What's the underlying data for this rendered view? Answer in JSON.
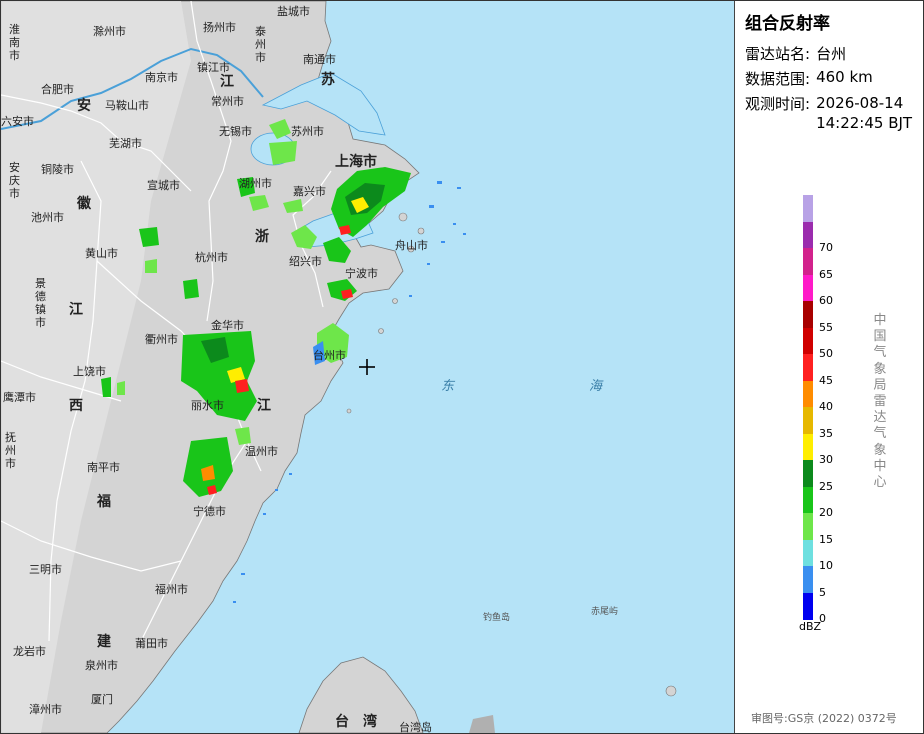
{
  "panel": {
    "title": "组合反射率",
    "station_key": "雷达站名:",
    "station_val": "台州",
    "range_key": "数据范围:",
    "range_val": "460 km",
    "time_key": "观测时间:",
    "time_date": "2026-08-14",
    "time_clock": "14:22:45 BJT",
    "vertical_text": "中国气象局雷达气象中心",
    "unit": "dBZ",
    "review": "审图号:GS京 (2022) 0372号"
  },
  "legend": [
    {
      "value": "",
      "color": "#b8a2e6"
    },
    {
      "value": "70",
      "color": "#9b2cae"
    },
    {
      "value": "65",
      "color": "#d2228c"
    },
    {
      "value": "60",
      "color": "#ff1ac8"
    },
    {
      "value": "55",
      "color": "#a80000"
    },
    {
      "value": "50",
      "color": "#d00000"
    },
    {
      "value": "45",
      "color": "#ff2020"
    },
    {
      "value": "40",
      "color": "#ff8c00"
    },
    {
      "value": "35",
      "color": "#e6b800"
    },
    {
      "value": "30",
      "color": "#ffee00"
    },
    {
      "value": "25",
      "color": "#0c8a1c"
    },
    {
      "value": "20",
      "color": "#19c519"
    },
    {
      "value": "15",
      "color": "#6ee64a"
    },
    {
      "value": "10",
      "color": "#6ee0e0"
    },
    {
      "value": "5",
      "color": "#3a8ff0"
    },
    {
      "value": "0",
      "color": "#0000f0"
    }
  ],
  "map": {
    "provinces": [
      "苏",
      "江",
      "安",
      "徽",
      "浙",
      "江",
      "江",
      "西",
      "福",
      "建",
      "台",
      "湾"
    ],
    "sea": [
      "东",
      "海"
    ],
    "islands": [
      "钓鱼岛",
      "赤尾屿",
      "台湾岛"
    ],
    "cities": [
      "淮南市",
      "滁州市",
      "扬州市",
      "泰州市",
      "盐城市",
      "合肥市",
      "南京市",
      "镇江市",
      "南通市",
      "六安市",
      "马鞍山市",
      "常州市",
      "芜湖市",
      "无锡市",
      "苏州市",
      "安庆市",
      "铜陵市",
      "宣城市",
      "上海市",
      "湖州市",
      "嘉兴市",
      "池州市",
      "黄山市",
      "杭州市",
      "绍兴市",
      "舟山市",
      "景德镇市",
      "宁波市",
      "衢州市",
      "金华市",
      "台州市",
      "上饶市",
      "鹰潭市",
      "丽水市",
      "抚州市",
      "温州市",
      "南平市",
      "宁德市",
      "三明市",
      "福州市",
      "龙岩市",
      "莆田市",
      "泉州市",
      "漳州市",
      "厦门"
    ]
  }
}
